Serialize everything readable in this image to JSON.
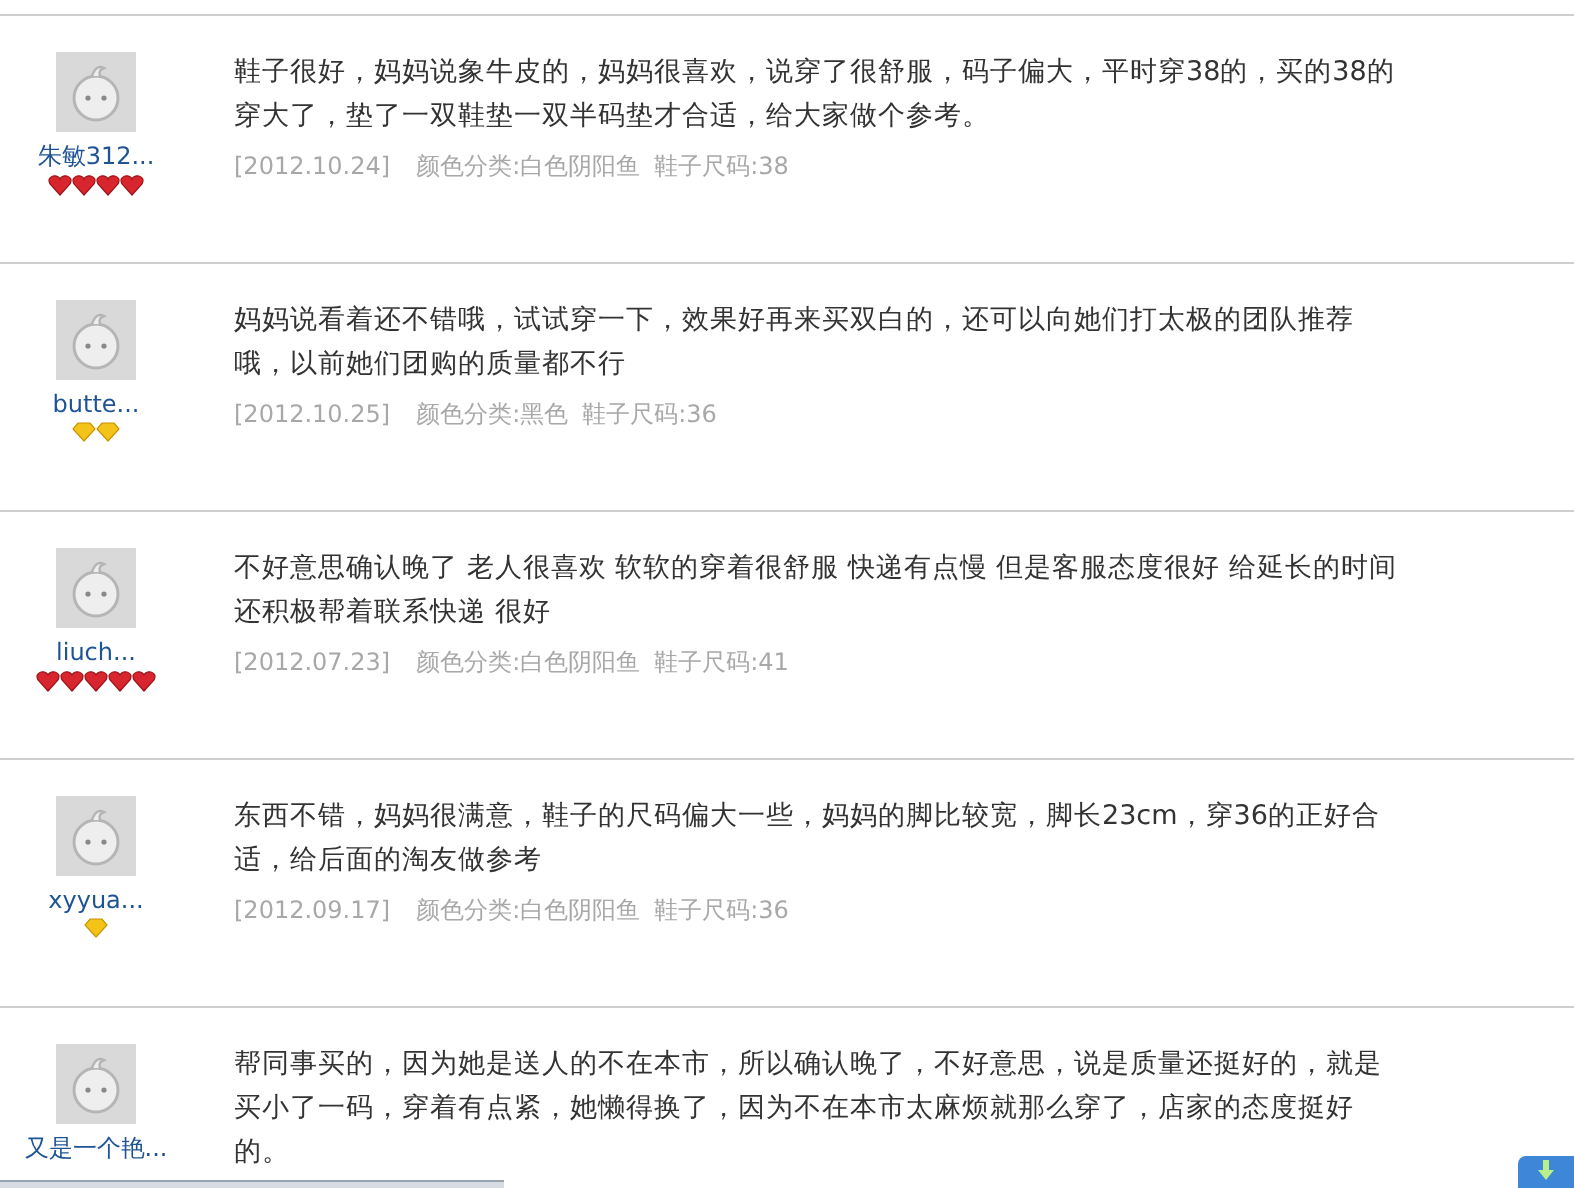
{
  "reviews": [
    {
      "username": "朱敏312...",
      "rank_icons": [
        {
          "kind": "heart"
        },
        {
          "kind": "heart"
        },
        {
          "kind": "heart"
        },
        {
          "kind": "heart"
        }
      ],
      "lines": [
        "鞋子很好，妈妈说象牛皮的，妈妈很喜欢，说穿了很舒服，码子偏大，平时穿38的，买的38的",
        "穿大了，垫了一双鞋垫一双半码垫才合适，给大家做个参考。"
      ],
      "date": "[2012.10.24]",
      "attributes": [
        "颜色分类:白色阴阳鱼",
        "鞋子尺码:38"
      ]
    },
    {
      "username": "butte...",
      "rank_icons": [
        {
          "kind": "diamond"
        },
        {
          "kind": "diamond"
        }
      ],
      "lines": [
        "妈妈说看着还不错哦，试试穿一下，效果好再来买双白的，还可以向她们打太极的团队推荐",
        "哦，以前她们团购的质量都不行"
      ],
      "date": "[2012.10.25]",
      "attributes": [
        "颜色分类:黑色",
        "鞋子尺码:36"
      ]
    },
    {
      "username": "liuch...",
      "rank_icons": [
        {
          "kind": "heart"
        },
        {
          "kind": "heart"
        },
        {
          "kind": "heart"
        },
        {
          "kind": "heart"
        },
        {
          "kind": "heart"
        }
      ],
      "lines": [
        "不好意思确认晚了 老人很喜欢 软软的穿着很舒服 快递有点慢 但是客服态度很好 给延长的时间",
        "还积极帮着联系快递 很好"
      ],
      "date": "[2012.07.23]",
      "attributes": [
        "颜色分类:白色阴阳鱼",
        "鞋子尺码:41"
      ]
    },
    {
      "username": "xyyua...",
      "rank_icons": [
        {
          "kind": "diamond"
        }
      ],
      "lines": [
        "东西不错，妈妈很满意，鞋子的尺码偏大一些，妈妈的脚比较宽，脚长23cm，穿36的正好合",
        "适，给后面的淘友做参考"
      ],
      "date": "[2012.09.17]",
      "attributes": [
        "颜色分类:白色阴阳鱼",
        "鞋子尺码:36"
      ]
    },
    {
      "username": "又是一个艳...",
      "lines": [
        "帮同事买的，因为她是送人的不在本市，所以确认晚了，不好意思，说是质量还挺好的，就是",
        "买小了一码，穿着有点紧，她懒得换了，因为不在本市太麻烦就那么穿了，店家的态度挺好",
        "的。"
      ]
    }
  ]
}
